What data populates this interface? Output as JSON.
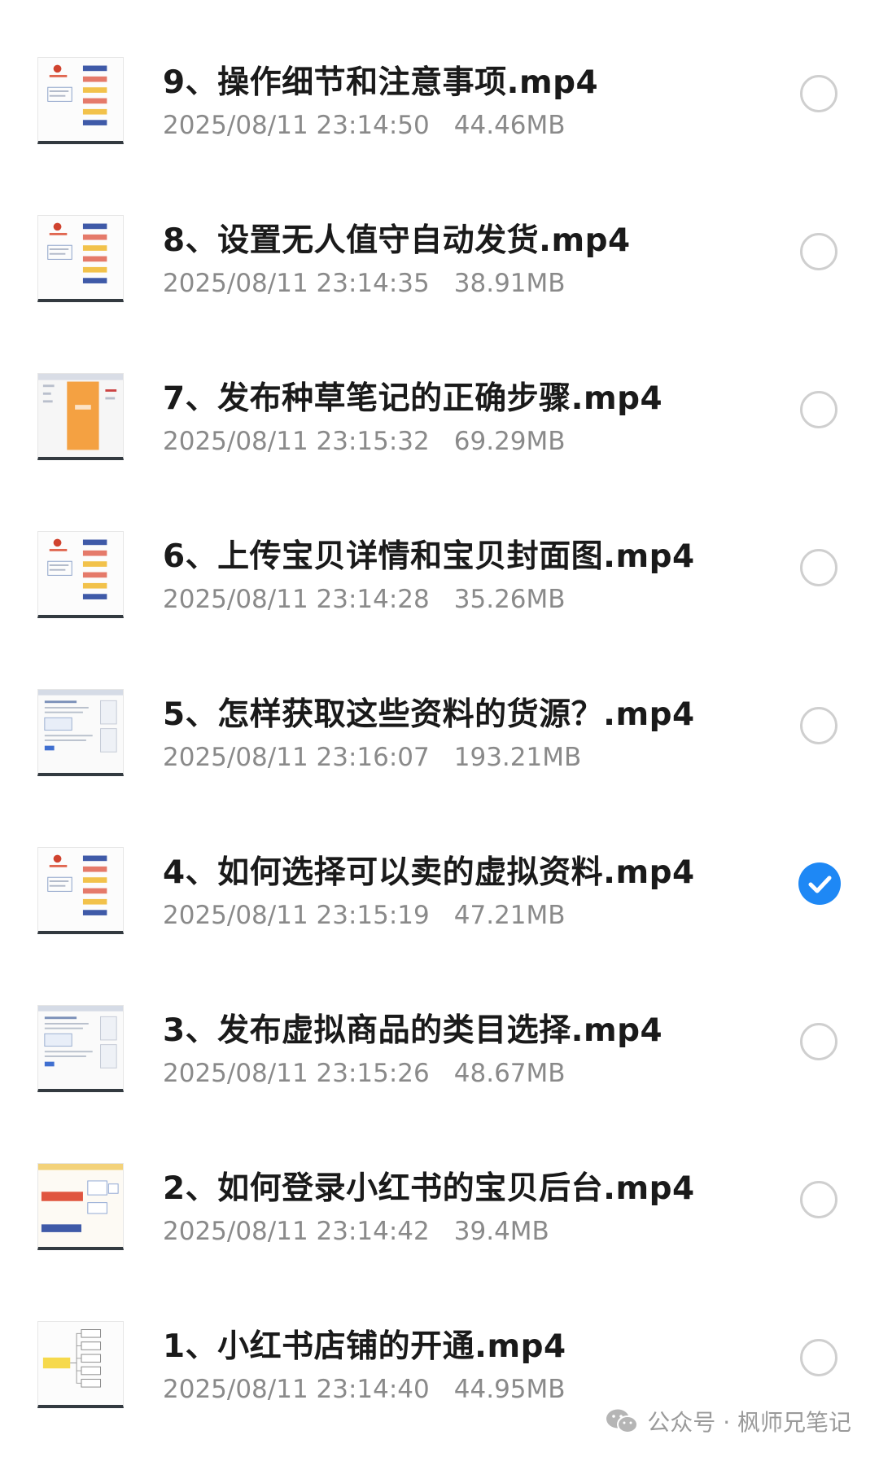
{
  "files": [
    {
      "title": "9、操作细节和注意事项.mp4",
      "date": "2025/08/11 23:14:50",
      "size": "44.46MB",
      "selected": false,
      "thumb": "document-with-buttons"
    },
    {
      "title": "8、设置无人值守自动发货.mp4",
      "date": "2025/08/11 23:14:35",
      "size": "38.91MB",
      "selected": false,
      "thumb": "document-with-buttons"
    },
    {
      "title": "7、发布种草笔记的正确步骤.mp4",
      "date": "2025/08/11 23:15:32",
      "size": "69.29MB",
      "selected": false,
      "thumb": "orange-phone-screen"
    },
    {
      "title": "6、上传宝贝详情和宝贝封面图.mp4",
      "date": "2025/08/11 23:14:28",
      "size": "35.26MB",
      "selected": false,
      "thumb": "document-with-buttons"
    },
    {
      "title": "5、怎样获取这些资料的货源？.mp4",
      "date": "2025/08/11 23:16:07",
      "size": "193.21MB",
      "selected": false,
      "thumb": "browser-page"
    },
    {
      "title": "4、如何选择可以卖的虚拟资料.mp4",
      "date": "2025/08/11 23:15:19",
      "size": "47.21MB",
      "selected": true,
      "thumb": "document-with-buttons"
    },
    {
      "title": "3、发布虚拟商品的类目选择.mp4",
      "date": "2025/08/11 23:15:26",
      "size": "48.67MB",
      "selected": false,
      "thumb": "browser-page"
    },
    {
      "title": "2、如何登录小红书的宝贝后台.mp4",
      "date": "2025/08/11 23:14:42",
      "size": "39.4MB",
      "selected": false,
      "thumb": "red-banner-slide"
    },
    {
      "title": "1、小红书店铺的开通.mp4",
      "date": "2025/08/11 23:14:40",
      "size": "44.95MB",
      "selected": false,
      "thumb": "mind-map"
    }
  ],
  "watermark": {
    "icon": "wechat-icon",
    "text": "公众号 · 枫师兄笔记"
  },
  "colors": {
    "accent": "#1e88f5",
    "title": "#1a1a1a",
    "meta": "#8a8a8a",
    "radio_border": "#cfcfcf"
  }
}
